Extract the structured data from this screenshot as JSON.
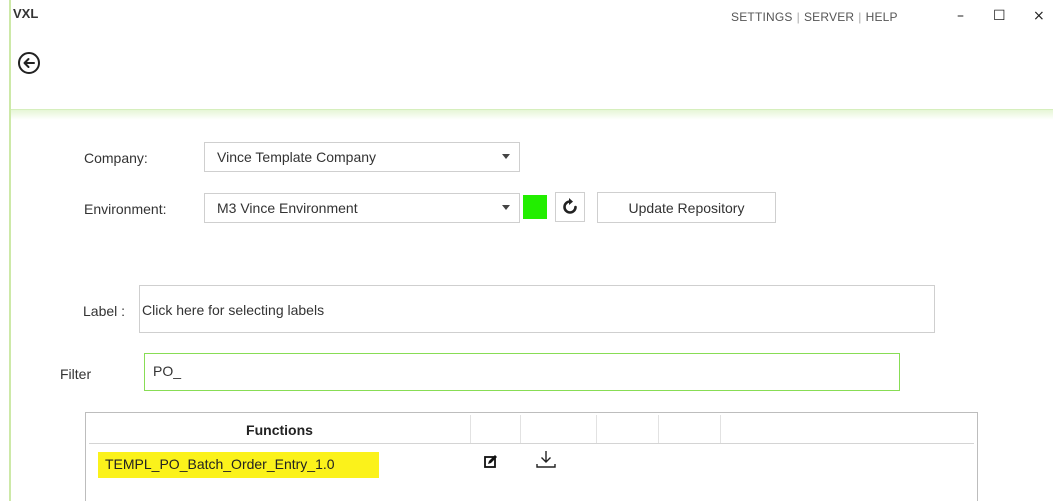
{
  "window": {
    "title": "VXL",
    "nav": [
      "SETTINGS",
      "SERVER",
      "HELP"
    ],
    "controls": {
      "minimize": "–",
      "maximize": "☐",
      "close": "×"
    }
  },
  "form": {
    "company_label": "Company:",
    "company_value": "Vince Template Company",
    "environment_label": "Environment:",
    "environment_value": "M3 Vince Environment",
    "status_color": "#22ee00",
    "update_button": "Update Repository",
    "label_label": "Label :",
    "label_placeholder": "Click here for selecting labels",
    "filter_label": "Filter",
    "filter_value": "PO_"
  },
  "table": {
    "header": "Functions",
    "rows": [
      {
        "name": "TEMPL_PO_Batch_Order_Entry_1.0"
      }
    ]
  },
  "colors": {
    "accent": "#88dd55",
    "highlight": "#fbf21b"
  }
}
